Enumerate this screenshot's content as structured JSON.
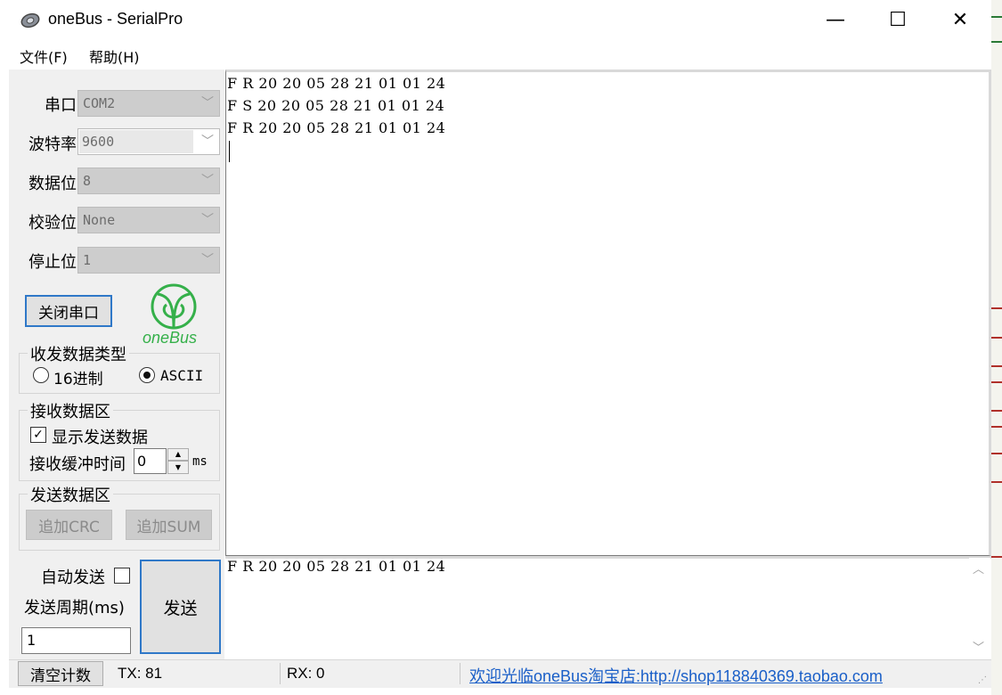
{
  "window": {
    "title": "oneBus - SerialPro",
    "controls": {
      "minimize": "—",
      "maximize": "☐",
      "close": "✕"
    }
  },
  "menu": {
    "file": "文件(F)",
    "help": "帮助(H)"
  },
  "port_settings": {
    "port": {
      "label": "串口",
      "value": "COM2"
    },
    "baud": {
      "label": "波特率",
      "value": "9600"
    },
    "databits": {
      "label": "数据位",
      "value": "8"
    },
    "parity": {
      "label": "校验位",
      "value": "None"
    },
    "stopbits": {
      "label": "停止位",
      "value": "1"
    },
    "close_port_label": "关闭串口"
  },
  "logo": {
    "text": "oneBus",
    "color": "#35b04a"
  },
  "data_type": {
    "title": "收发数据类型",
    "hex_label": "16进制",
    "ascii_label": "ASCII",
    "selected": "ASCII"
  },
  "receive_group": {
    "title": "接收数据区",
    "show_send_label": "显示发送数据",
    "show_send_checked": true,
    "buffer_label": "接收缓冲时间",
    "buffer_value": "0",
    "unit": "ms"
  },
  "send_group": {
    "title": "发送数据区",
    "crc_label": "追加CRC",
    "sum_label": "追加SUM"
  },
  "receive_lines": [
    "F R 20 20 05 28 21 01 01 24",
    "F S 20 20 05 28 21 01 01 24",
    "F R 20 20 05 28 21 01 01 24"
  ],
  "send_panel": {
    "auto_send_label": "自动发送",
    "auto_send_checked": false,
    "period_label": "发送周期(ms)",
    "period_value": "1",
    "send_label": "发送",
    "send_text": "F R 20 20 05 28 21 01 01 24"
  },
  "status": {
    "clear_label": "清空计数",
    "tx": "TX:  81",
    "rx": "RX:  0",
    "shop_link": "欢迎光临oneBus淘宝店:http://shop118840369.taobao.com"
  },
  "colors": {
    "accent": "#2f78c8",
    "link": "#1a5fc8"
  }
}
